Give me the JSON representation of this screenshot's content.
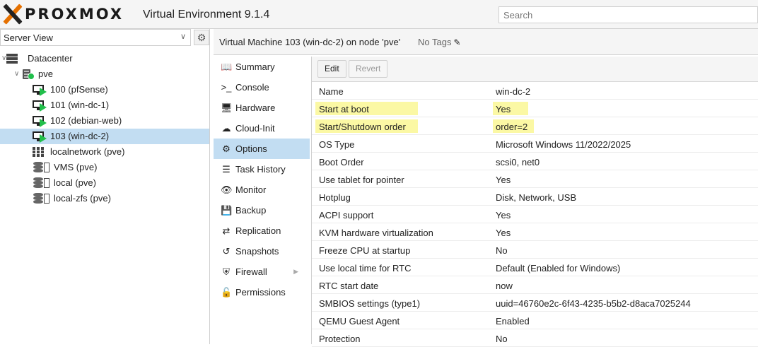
{
  "header": {
    "brand": "PROXMOX",
    "app_version": "Virtual Environment 9.1.4",
    "search_placeholder": "Search"
  },
  "left_panel": {
    "view_select": "Server View",
    "tree": [
      {
        "label": "Datacenter",
        "icon": "datacenter-icon",
        "level": 0,
        "selected": false
      },
      {
        "label": "pve",
        "icon": "node-online-icon",
        "level": 1,
        "selected": false
      },
      {
        "label": "100 (pfSense)",
        "icon": "vm-running-icon",
        "level": 2,
        "selected": false
      },
      {
        "label": "101 (win-dc-1)",
        "icon": "vm-running-icon",
        "level": 2,
        "selected": false
      },
      {
        "label": "102 (debian-web)",
        "icon": "vm-running-icon",
        "level": 2,
        "selected": false
      },
      {
        "label": "103 (win-dc-2)",
        "icon": "vm-running-icon",
        "level": 2,
        "selected": true
      },
      {
        "label": "localnetwork (pve)",
        "icon": "network-grid-icon",
        "level": 2,
        "selected": false
      },
      {
        "label": "VMS (pve)",
        "icon": "storage-icon",
        "level": 2,
        "selected": false
      },
      {
        "label": "local (pve)",
        "icon": "storage-icon",
        "level": 2,
        "selected": false
      },
      {
        "label": "local-zfs (pve)",
        "icon": "storage-icon",
        "level": 2,
        "selected": false
      }
    ]
  },
  "vm_header": {
    "title": "Virtual Machine 103 (win-dc-2) on node 'pve'",
    "tags": "No Tags"
  },
  "nav": [
    {
      "label": "Summary",
      "icon": "book-icon",
      "glyph": "📖",
      "selected": false
    },
    {
      "label": "Console",
      "icon": "terminal-icon",
      "glyph": ">_",
      "selected": false
    },
    {
      "label": "Hardware",
      "icon": "monitor-icon",
      "glyph": "🖥",
      "selected": false
    },
    {
      "label": "Cloud-Init",
      "icon": "cloud-icon",
      "glyph": "☁",
      "selected": false
    },
    {
      "label": "Options",
      "icon": "gear-icon",
      "glyph": "⚙",
      "selected": true
    },
    {
      "label": "Task History",
      "icon": "list-icon",
      "glyph": "☰",
      "selected": false
    },
    {
      "label": "Monitor",
      "icon": "eye-icon",
      "glyph": "👁",
      "selected": false
    },
    {
      "label": "Backup",
      "icon": "floppy-icon",
      "glyph": "💾",
      "selected": false
    },
    {
      "label": "Replication",
      "icon": "retweet-icon",
      "glyph": "⇄",
      "selected": false
    },
    {
      "label": "Snapshots",
      "icon": "history-icon",
      "glyph": "↺",
      "selected": false
    },
    {
      "label": "Firewall",
      "icon": "shield-icon",
      "glyph": "⛨",
      "selected": false,
      "has_submenu": true
    },
    {
      "label": "Permissions",
      "icon": "unlock-icon",
      "glyph": "🔓",
      "selected": false
    }
  ],
  "toolbar": {
    "edit_label": "Edit",
    "revert_label": "Revert"
  },
  "options": [
    {
      "key": "Name",
      "value": "win-dc-2",
      "highlight": false
    },
    {
      "key": "Start at boot",
      "value": "Yes",
      "highlight": true
    },
    {
      "key": "Start/Shutdown order",
      "value": "order=2",
      "highlight": true
    },
    {
      "key": "OS Type",
      "value": "Microsoft Windows 11/2022/2025",
      "highlight": false
    },
    {
      "key": "Boot Order",
      "value": "scsi0, net0",
      "highlight": false
    },
    {
      "key": "Use tablet for pointer",
      "value": "Yes",
      "highlight": false
    },
    {
      "key": "Hotplug",
      "value": "Disk, Network, USB",
      "highlight": false
    },
    {
      "key": "ACPI support",
      "value": "Yes",
      "highlight": false
    },
    {
      "key": "KVM hardware virtualization",
      "value": "Yes",
      "highlight": false
    },
    {
      "key": "Freeze CPU at startup",
      "value": "No",
      "highlight": false
    },
    {
      "key": "Use local time for RTC",
      "value": "Default (Enabled for Windows)",
      "highlight": false
    },
    {
      "key": "RTC start date",
      "value": "now",
      "highlight": false
    },
    {
      "key": "SMBIOS settings (type1)",
      "value": "uuid=46760e2c-6f43-4235-b5b2-d8aca7025244",
      "highlight": false
    },
    {
      "key": "QEMU Guest Agent",
      "value": "Enabled",
      "highlight": false
    },
    {
      "key": "Protection",
      "value": "No",
      "highlight": false
    }
  ],
  "colors": {
    "accent_orange": "#e57000",
    "selected_bg": "#c2ddf2",
    "highlight": "#fbf8a4",
    "running_green": "#21bf4b"
  }
}
